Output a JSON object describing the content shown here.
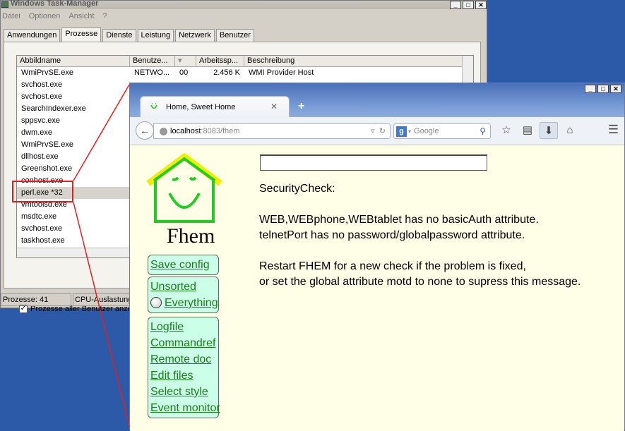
{
  "taskmgr": {
    "title": "Windows Task-Manager",
    "menu": [
      "Datei",
      "Optionen",
      "Ansicht",
      "?"
    ],
    "tabs": [
      "Anwendungen",
      "Prozesse",
      "Dienste",
      "Leistung",
      "Netzwerk",
      "Benutzer"
    ],
    "active_tab": "Prozesse",
    "columns": [
      "Abbildname",
      "Benutze...",
      "",
      "Arbeitssp...",
      "Beschreibung"
    ],
    "rows": [
      {
        "name": "WmiPrvSE.exe",
        "user": "NETWO...",
        "cpu": "00",
        "mem": "2.456 K",
        "desc": "WMI Provider Host"
      },
      {
        "name": "svchost.exe"
      },
      {
        "name": "svchost.exe"
      },
      {
        "name": "SearchIndexer.exe"
      },
      {
        "name": "sppsvc.exe"
      },
      {
        "name": "dwm.exe"
      },
      {
        "name": "WmiPrvSE.exe"
      },
      {
        "name": "dllhost.exe"
      },
      {
        "name": "Greenshot.exe"
      },
      {
        "name": "conhost.exe"
      },
      {
        "name": "perl.exe *32"
      },
      {
        "name": "vmtoolsd.exe"
      },
      {
        "name": "msdtc.exe"
      },
      {
        "name": "svchost.exe"
      },
      {
        "name": "taskhost.exe"
      }
    ],
    "selected_row": "perl.exe *32",
    "all_users_checkbox": {
      "label": "Prozesse aller Benutzer anzeig",
      "checked": true
    },
    "status": {
      "processes": "Prozesse: 41",
      "cpu": "CPU-Auslastung"
    }
  },
  "firefox": {
    "tab_title": "Home, Sweet Home",
    "new_tab": "+",
    "url_host": "localhost",
    "url_rest": ":8083/fhem",
    "search_placeholder": "Google",
    "search_engine": "g"
  },
  "fhem": {
    "logo_text": "Fhem",
    "menu_group1": [
      "Save config"
    ],
    "menu_group2": [
      "Unsorted",
      "Everything"
    ],
    "menu_group3": [
      "Logfile",
      "Commandref",
      "Remote doc",
      "Edit files",
      "Select style",
      "Event monitor"
    ],
    "command_input": "",
    "message": {
      "heading": "SecurityCheck:",
      "line1": "WEB,WEBphone,WEBtablet has no basicAuth attribute.",
      "line2": "telnetPort has no password/globalpassword attribute.",
      "line3": "Restart FHEM for a new check if the problem is fixed,",
      "line4": "or set the global attribute motd to none to supress this message."
    }
  },
  "colors": {
    "desktop": "#2c5aa8",
    "annotation_red": "#e02020",
    "fhem_bg": "#ffffe7",
    "fhem_link": "#1b7d1b",
    "fhem_menu_bg": "#ccffe7",
    "logo_green": "#22cc22",
    "logo_yellow": "#eeee00"
  }
}
